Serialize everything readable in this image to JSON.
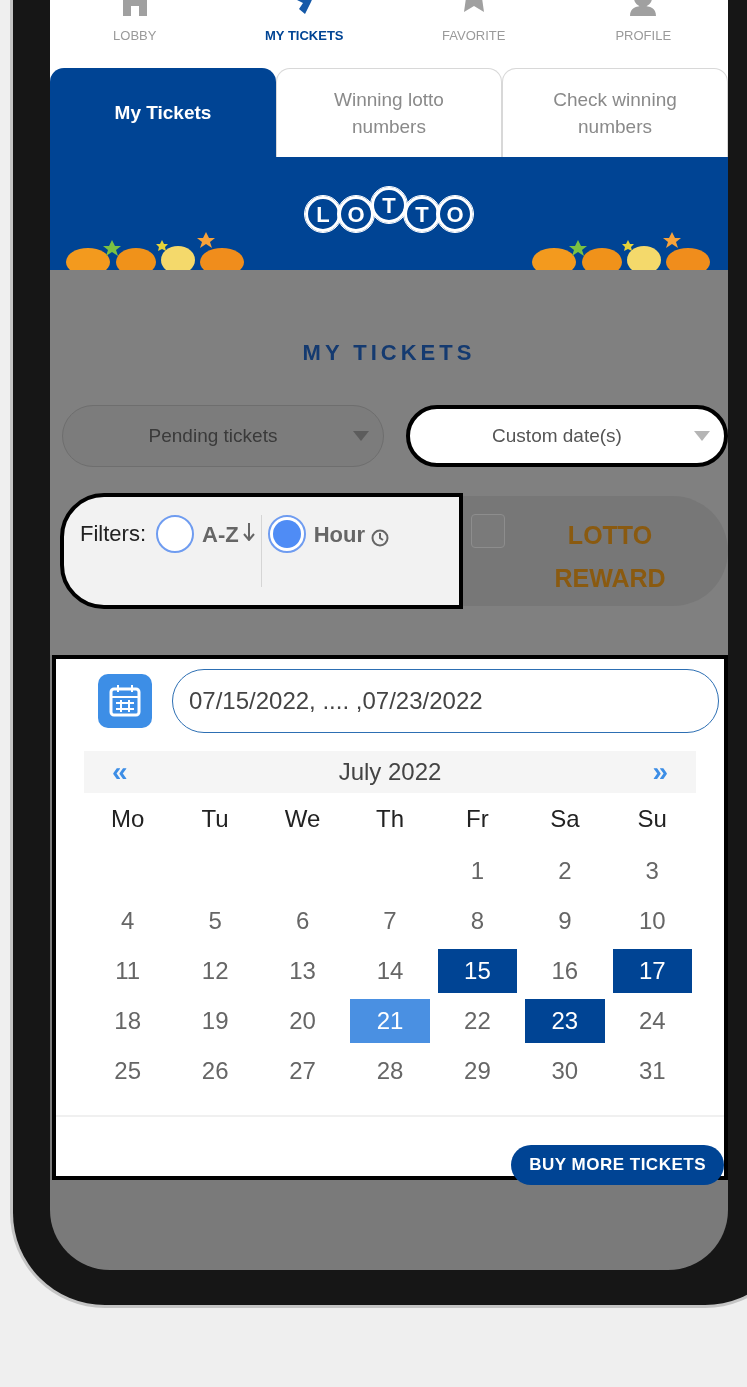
{
  "bottom_nav": [
    {
      "label": "LOBBY",
      "selected": false
    },
    {
      "label": "MY TICKETS",
      "selected": true
    },
    {
      "label": "FAVORITE",
      "selected": false
    },
    {
      "label": "PROFILE",
      "selected": false
    }
  ],
  "tabs": [
    {
      "label": "My Tickets",
      "selected": true
    },
    {
      "label": "Winning lotto numbers",
      "selected": false
    },
    {
      "label": "Check winning numbers",
      "selected": false
    }
  ],
  "banner": {
    "logo_letters": [
      "L",
      "O",
      "T",
      "T",
      "O"
    ]
  },
  "title": "MY TICKETS",
  "dropdowns": [
    {
      "value": "Pending tickets",
      "highlighted": false
    },
    {
      "value": "Custom date(s)",
      "highlighted": true
    }
  ],
  "filters": {
    "label": "Filters:",
    "options": [
      {
        "label": "A-Z",
        "selected": false
      },
      {
        "label": "Hour",
        "selected": true
      }
    ]
  },
  "reward": {
    "label": "LOTTO REWARD",
    "checked": false
  },
  "date_field": {
    "value": "07/15/2022, .... ,07/23/2022"
  },
  "calendar": {
    "month": "July 2022",
    "prev": "«",
    "next": "»",
    "weekdays": [
      "Mo",
      "Tu",
      "We",
      "Th",
      "Fr",
      "Sa",
      "Su"
    ],
    "weeks": [
      [
        {
          "label": "1",
          "selected": false,
          "today": false
        },
        {
          "label": "2",
          "selected": false,
          "today": false
        },
        {
          "label": "3",
          "selected": false,
          "today": false
        }
      ],
      [
        {
          "label": "4",
          "selected": false,
          "today": false
        },
        {
          "label": "5",
          "selected": false,
          "today": false
        },
        {
          "label": "6",
          "selected": false,
          "today": false
        },
        {
          "label": "7",
          "selected": false,
          "today": false
        },
        {
          "label": "8",
          "selected": false,
          "today": false
        },
        {
          "label": "9",
          "selected": false,
          "today": false
        },
        {
          "label": "10",
          "selected": false,
          "today": false
        }
      ],
      [
        {
          "label": "11",
          "selected": false,
          "today": false
        },
        {
          "label": "12",
          "selected": false,
          "today": false
        },
        {
          "label": "13",
          "selected": false,
          "today": false
        },
        {
          "label": "14",
          "selected": false,
          "today": false
        },
        {
          "label": "15",
          "selected": true,
          "today": false
        },
        {
          "label": "16",
          "selected": false,
          "today": false
        },
        {
          "label": "17",
          "selected": true,
          "today": false
        }
      ],
      [
        {
          "label": "18",
          "selected": false,
          "today": false
        },
        {
          "label": "19",
          "selected": false,
          "today": false
        },
        {
          "label": "20",
          "selected": false,
          "today": false
        },
        {
          "label": "21",
          "selected": false,
          "today": true
        },
        {
          "label": "22",
          "selected": false,
          "today": false
        },
        {
          "label": "23",
          "selected": true,
          "today": false
        },
        {
          "label": "24",
          "selected": false,
          "today": false
        }
      ],
      [
        {
          "label": "25",
          "selected": false,
          "today": false
        },
        {
          "label": "26",
          "selected": false,
          "today": false
        },
        {
          "label": "27",
          "selected": false,
          "today": false
        },
        {
          "label": "28",
          "selected": false,
          "today": false
        },
        {
          "label": "29",
          "selected": false,
          "today": false
        },
        {
          "label": "30",
          "selected": false,
          "today": false
        },
        {
          "label": "31",
          "selected": false,
          "today": false
        }
      ]
    ]
  },
  "buy_button": "BUY MORE TICKETS"
}
